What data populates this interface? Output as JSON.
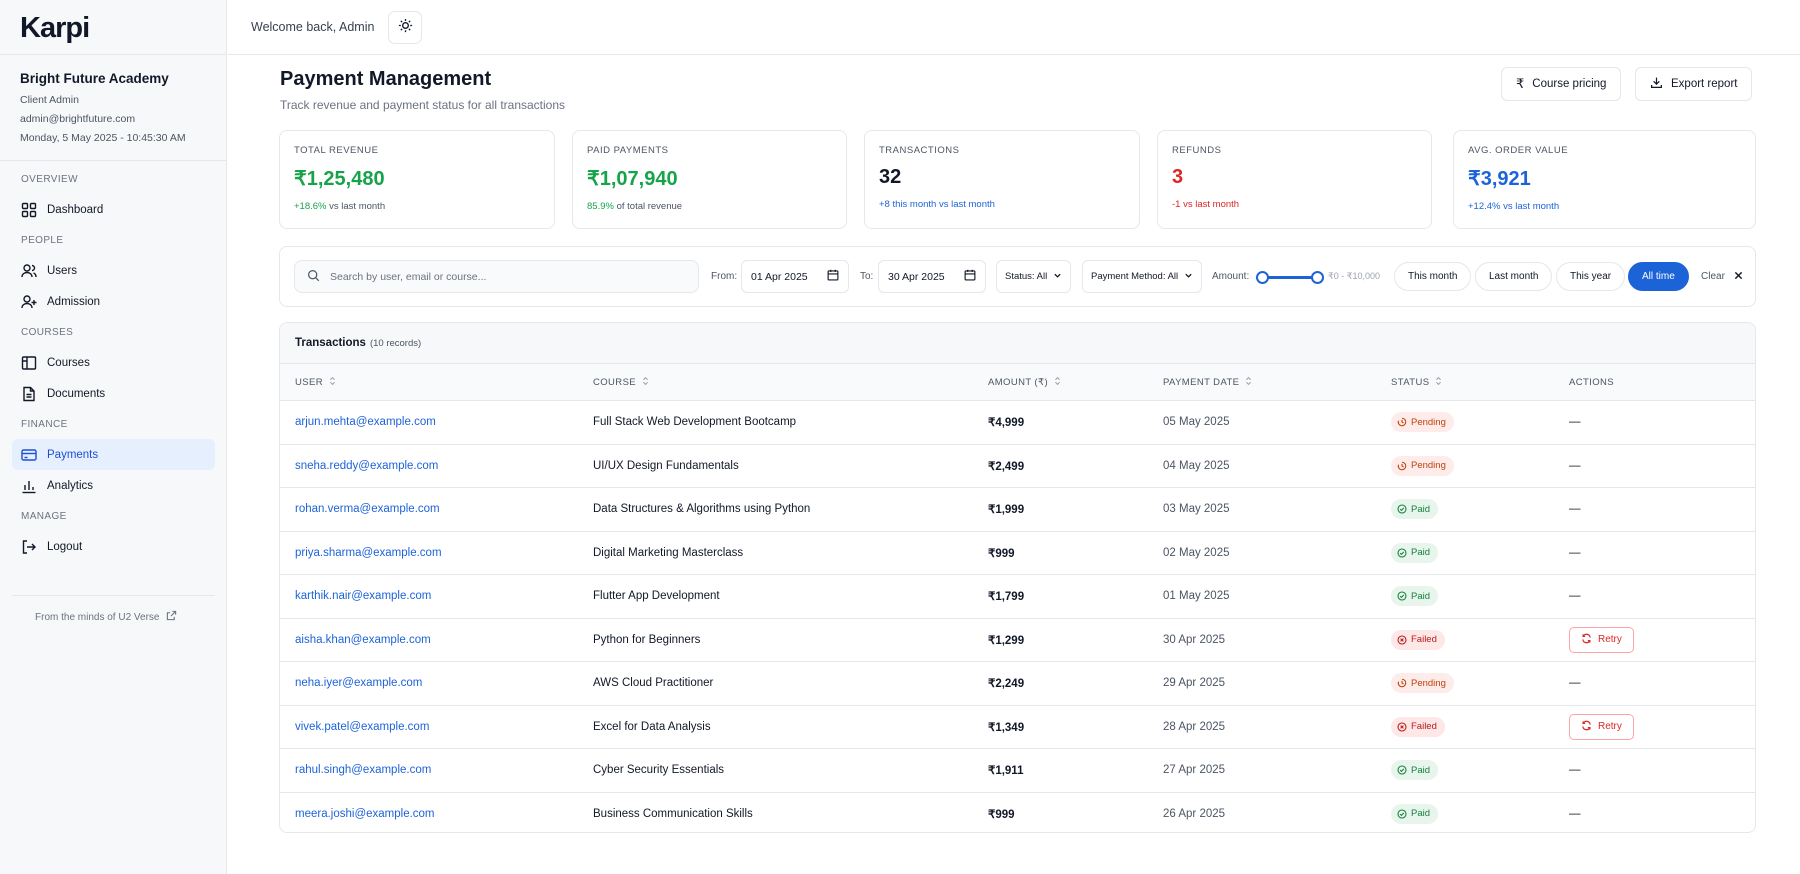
{
  "app": {
    "logo": "Karpi"
  },
  "org": {
    "name": "Bright Future Academy",
    "role": "Client Admin",
    "email": "admin@brightfuture.com",
    "datetime": "Monday, 5 May 2025 - 10:45:30 AM"
  },
  "nav": {
    "sections": {
      "overview": "OVERVIEW",
      "people": "PEOPLE",
      "courses": "COURSES",
      "finance": "FINANCE",
      "manage": "MANAGE"
    },
    "items": {
      "dashboard": "Dashboard",
      "users": "Users",
      "admission": "Admission",
      "courses": "Courses",
      "documents": "Documents",
      "payments": "Payments",
      "analytics": "Analytics",
      "logout": "Logout"
    },
    "active": "payments"
  },
  "footer": {
    "note": "From the minds of U2 Verse"
  },
  "topbar": {
    "welcome": "Welcome back, Admin"
  },
  "page": {
    "title": "Payment Management",
    "subtitle": "Track revenue and payment status for all transactions",
    "course_pricing": "Course pricing",
    "export_report": "Export report"
  },
  "stats": [
    {
      "label": "TOTAL REVENUE",
      "value": "₹1,25,480",
      "trend_strong": "+18.6%",
      "trend_rest": "vs last month",
      "color": "#16a34a"
    },
    {
      "label": "PAID PAYMENTS",
      "value": "₹1,07,940",
      "trend_strong": "85.9%",
      "trend_rest": "of total revenue",
      "color": "#16a34a"
    },
    {
      "label": "TRANSACTIONS",
      "value": "32",
      "trend_strong": "+8",
      "trend_rest": "this month vs last month",
      "color": "#111827"
    },
    {
      "label": "REFUNDS",
      "value": "3",
      "trend_strong": "-1",
      "trend_rest": "vs last month",
      "color": "#dc2626"
    },
    {
      "label": "AVG. ORDER VALUE",
      "value": "₹3,921",
      "trend_strong": "+12.4%",
      "trend_rest": "vs last month",
      "color": "#1d63d8"
    }
  ],
  "filters": {
    "search_placeholder": "Search by user, email or course...",
    "from_label": "From:",
    "from_value": "01 Apr 2025",
    "to_label": "To:",
    "to_value": "30 Apr 2025",
    "status": "Status: All",
    "payment_method": "Payment Method: All",
    "amount_label": "Amount:",
    "amount_range": "₹0 - ₹10,000",
    "this_month": "This month",
    "last_month": "Last month",
    "this_year": "This year",
    "all_time": "All time",
    "clear": "Clear"
  },
  "table": {
    "title": "Transactions",
    "count": "(10 records)",
    "columns": {
      "user": "USER",
      "course": "COURSE",
      "amount": "AMOUNT (₹)",
      "date": "PAYMENT DATE",
      "status": "STATUS",
      "actions": "ACTIONS"
    },
    "retry_label": "Retry",
    "rows": [
      {
        "user": "arjun.mehta@example.com",
        "course": "Full Stack Web Development Bootcamp",
        "amount": "₹4,999",
        "date": "05 May 2025",
        "status": "Pending",
        "action": "—"
      },
      {
        "user": "sneha.reddy@example.com",
        "course": "UI/UX Design Fundamentals",
        "amount": "₹2,499",
        "date": "04 May 2025",
        "status": "Pending",
        "action": "—"
      },
      {
        "user": "rohan.verma@example.com",
        "course": "Data Structures & Algorithms using Python",
        "amount": "₹1,999",
        "date": "03 May 2025",
        "status": "Paid",
        "action": "—"
      },
      {
        "user": "priya.sharma@example.com",
        "course": "Digital Marketing Masterclass",
        "amount": "₹999",
        "date": "02 May 2025",
        "status": "Paid",
        "action": "—"
      },
      {
        "user": "karthik.nair@example.com",
        "course": "Flutter App Development",
        "amount": "₹1,799",
        "date": "01 May 2025",
        "status": "Paid",
        "action": "—"
      },
      {
        "user": "aisha.khan@example.com",
        "course": "Python for Beginners",
        "amount": "₹1,299",
        "date": "30 Apr 2025",
        "status": "Failed",
        "action": "Retry"
      },
      {
        "user": "neha.iyer@example.com",
        "course": "AWS Cloud Practitioner",
        "amount": "₹2,249",
        "date": "29 Apr 2025",
        "status": "Pending",
        "action": "—"
      },
      {
        "user": "vivek.patel@example.com",
        "course": "Excel for Data Analysis",
        "amount": "₹1,349",
        "date": "28 Apr 2025",
        "status": "Failed",
        "action": "Retry"
      },
      {
        "user": "rahul.singh@example.com",
        "course": "Cyber Security Essentials",
        "amount": "₹1,911",
        "date": "27 Apr 2025",
        "status": "Paid",
        "action": "—"
      },
      {
        "user": "meera.joshi@example.com",
        "course": "Business Communication Skills",
        "amount": "₹999",
        "date": "26 Apr 2025",
        "status": "Paid",
        "action": "—"
      }
    ]
  },
  "colors": {
    "accent": "#1d63d8",
    "paid": "#15803d",
    "pending": "#c2410c",
    "failed": "#b91c1c"
  }
}
